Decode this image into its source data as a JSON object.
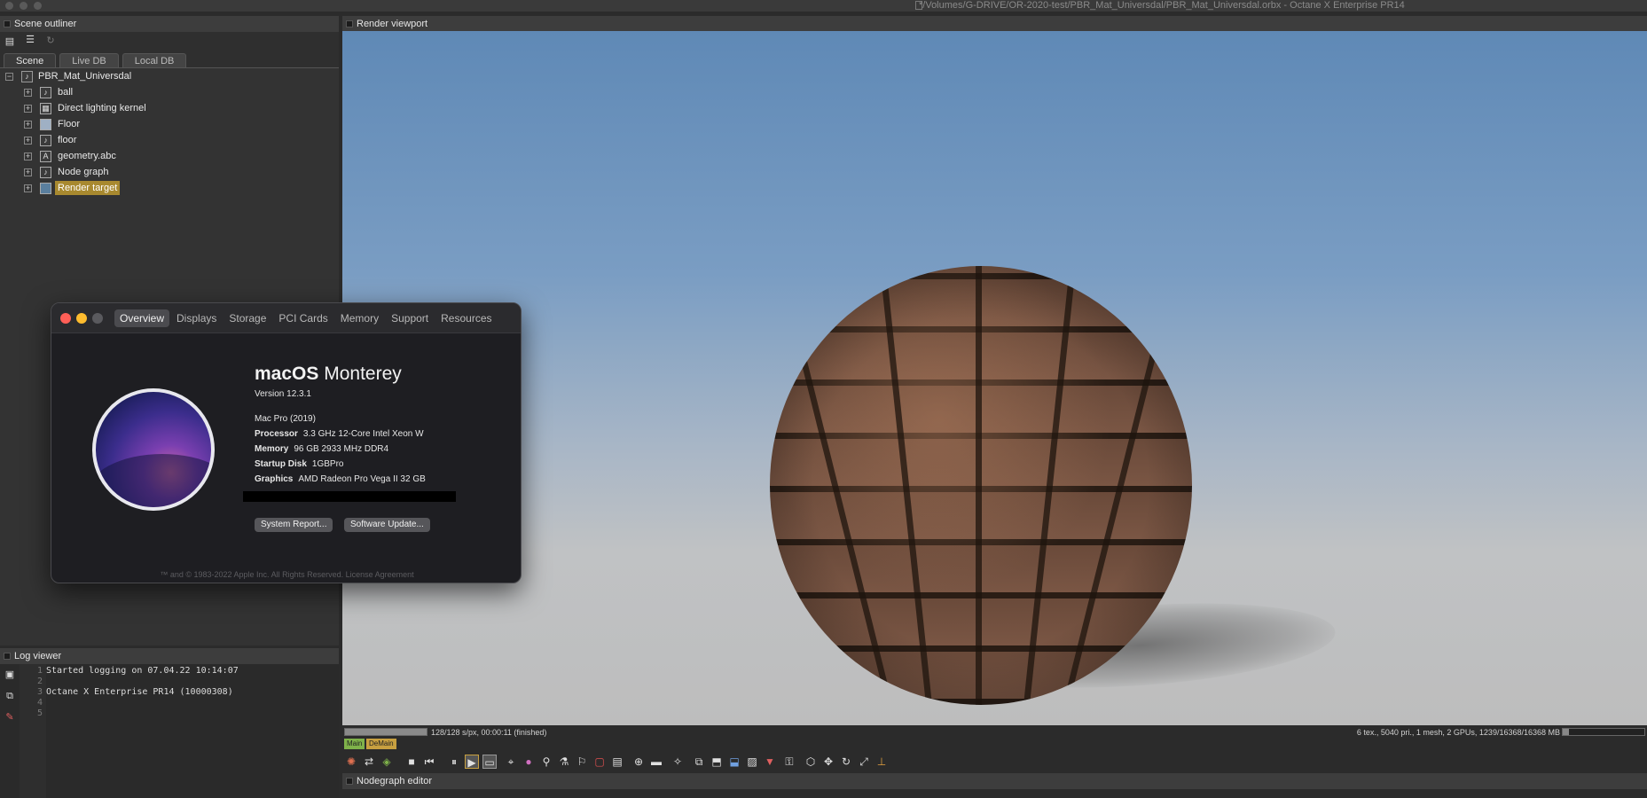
{
  "window": {
    "title": "*/Volumes/G-DRIVE/OR-2020-test/PBR_Mat_Universdal/PBR_Mat_Universdal.orbx - Octane X Enterprise PR14"
  },
  "outliner": {
    "header": "Scene outliner",
    "tabs": [
      "Scene",
      "Live DB",
      "Local DB"
    ],
    "root": "PBR_Mat_Universdal",
    "items": [
      {
        "label": "ball",
        "icon": "mesh-icon"
      },
      {
        "label": "Direct lighting kernel",
        "icon": "kernel-icon"
      },
      {
        "label": "Floor",
        "icon": "material-icon"
      },
      {
        "label": "floor",
        "icon": "mesh-icon"
      },
      {
        "label": "geometry.abc",
        "icon": "geometry-icon"
      },
      {
        "label": "Node graph",
        "icon": "nodegraph-icon"
      },
      {
        "label": "Render target",
        "icon": "render-target-icon"
      }
    ]
  },
  "log": {
    "header": "Log viewer",
    "lines": [
      {
        "num": "1",
        "text": "Started logging on 07.04.22 10:14:07"
      },
      {
        "num": "2",
        "text": ""
      },
      {
        "num": "3",
        "text": "Octane X Enterprise PR14 (10000308)"
      },
      {
        "num": "4",
        "text": ""
      },
      {
        "num": "5",
        "text": ""
      }
    ]
  },
  "viewport": {
    "header": "Render viewport",
    "progress_text": "128/128 s/px, 00:00:11 (finished)",
    "progress_fraction": 1.0,
    "stats_text": "6 tex., 5040 pri., 1 mesh, 2 GPUs, 1239/16368/16368 MB",
    "memory_fraction": 0.08,
    "tags": [
      "Main",
      "DeMain"
    ]
  },
  "nodegraph": {
    "header": "Nodegraph editor"
  },
  "about": {
    "tabs": [
      "Overview",
      "Displays",
      "Storage",
      "PCI Cards",
      "Memory",
      "Support",
      "Resources"
    ],
    "os_name_bold": "macOS",
    "os_name": "Monterey",
    "version": "Version 12.3.1",
    "model": "Mac Pro (2019)",
    "specs": [
      {
        "label": "Processor",
        "value": "3.3 GHz 12-Core Intel Xeon W"
      },
      {
        "label": "Memory",
        "value": "96 GB 2933 MHz DDR4"
      },
      {
        "label": "Startup Disk",
        "value": "1GBPro"
      },
      {
        "label": "Graphics",
        "value": "AMD Radeon Pro Vega II 32 GB"
      }
    ],
    "buttons": [
      "System Report...",
      "Software Update..."
    ],
    "footer": "™ and © 1983-2022 Apple Inc. All Rights Reserved. License Agreement"
  },
  "colors": {
    "accent_selected": "#a8892f",
    "tag_main": "#7fb24a",
    "tag_demain": "#c8a040",
    "close": "#ff5f57",
    "minimize": "#febc2e",
    "zoom": "#5a5a5e"
  }
}
